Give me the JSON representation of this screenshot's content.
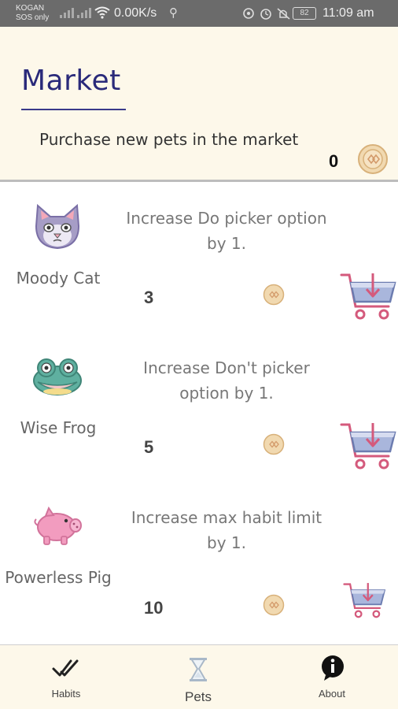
{
  "status_bar": {
    "carrier_line1": "KOGAN",
    "carrier_line2": "SOS only",
    "net_speed": "0.00K/s",
    "battery": "82",
    "time": "11:09 am"
  },
  "header": {
    "title": "Market",
    "subtitle": "Purchase new pets in the market",
    "coin_balance": "0"
  },
  "pets": [
    {
      "name": "Moody Cat",
      "description": "Increase Do picker option by 1.",
      "price": "3",
      "icon": "cat-icon"
    },
    {
      "name": "Wise Frog",
      "description": "Increase Don't picker option by 1.",
      "price": "5",
      "icon": "frog-icon"
    },
    {
      "name": "Powerless Pig",
      "description": "Increase max habit limit by 1.",
      "price": "10",
      "icon": "pig-icon"
    }
  ],
  "nav": {
    "habits_label": "Habits",
    "pets_label": "Pets",
    "about_label": "About"
  },
  "colors": {
    "header_bg": "#fdf8ea",
    "title": "#2a2a7a",
    "coin": "#e8c89a",
    "cart": "#7c8fc4",
    "status_bar": "#6b6b6b"
  }
}
